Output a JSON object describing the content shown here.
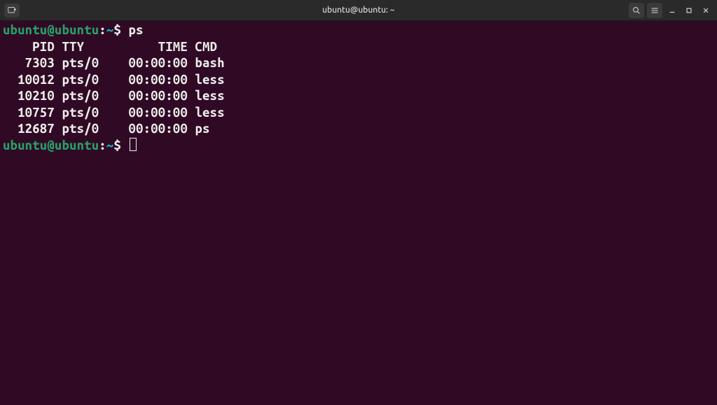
{
  "window": {
    "title": "ubuntu@ubuntu: ~"
  },
  "prompt": {
    "user_host": "ubuntu@ubuntu",
    "separator": ":",
    "path": "~",
    "symbol": "$"
  },
  "command": {
    "text": "ps"
  },
  "output": {
    "header": "    PID TTY          TIME CMD",
    "rows": [
      {
        "pid": "7303",
        "tty": "pts/0",
        "time": "00:00:00",
        "cmd": "bash"
      },
      {
        "pid": "10012",
        "tty": "pts/0",
        "time": "00:00:00",
        "cmd": "less"
      },
      {
        "pid": "10210",
        "tty": "pts/0",
        "time": "00:00:00",
        "cmd": "less"
      },
      {
        "pid": "10757",
        "tty": "pts/0",
        "time": "00:00:00",
        "cmd": "less"
      },
      {
        "pid": "12687",
        "tty": "pts/0",
        "time": "00:00:00",
        "cmd": "ps"
      }
    ],
    "lines": [
      "   7303 pts/0    00:00:00 bash",
      "  10012 pts/0    00:00:00 less",
      "  10210 pts/0    00:00:00 less",
      "  10757 pts/0    00:00:00 less",
      "  12687 pts/0    00:00:00 ps"
    ]
  }
}
